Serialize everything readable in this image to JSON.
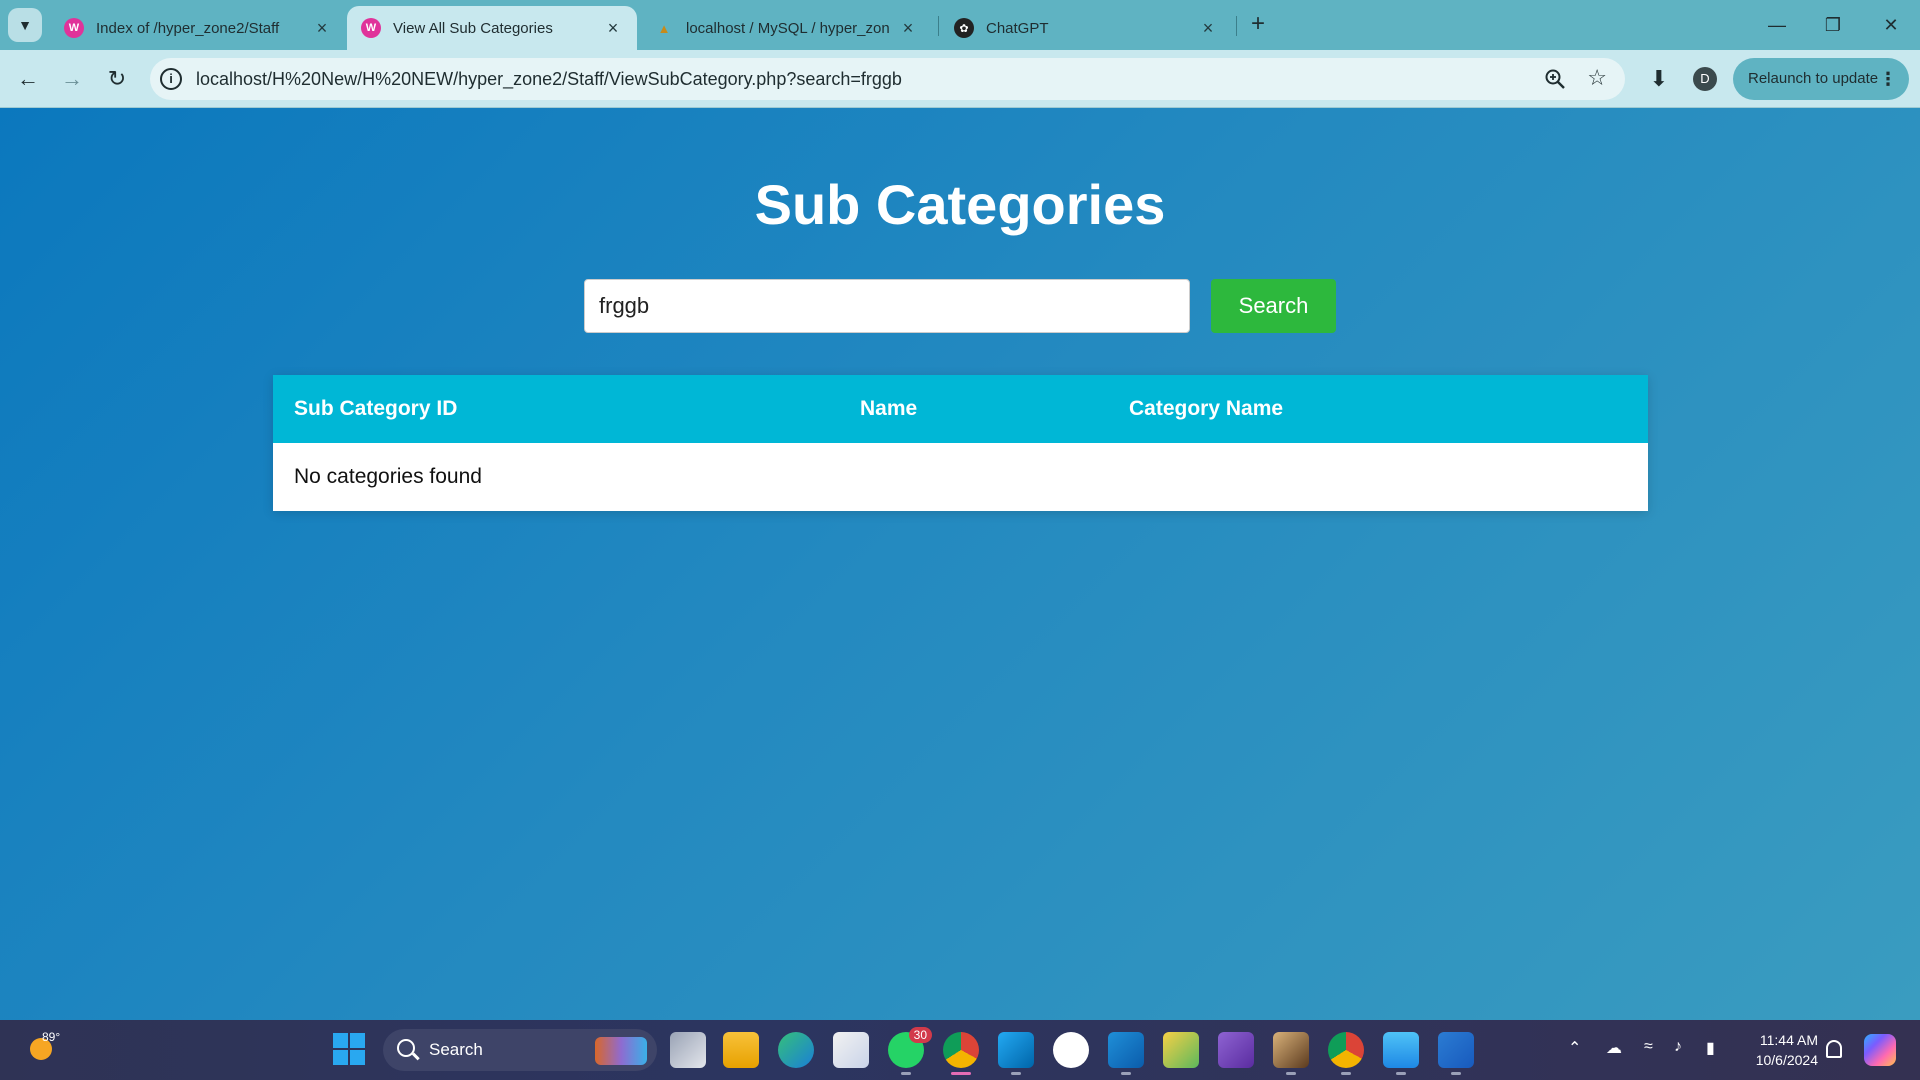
{
  "browser": {
    "tabs": [
      {
        "title": "Index of /hyper_zone2/Staff",
        "icon": "wamp-icon",
        "active": false
      },
      {
        "title": "View All Sub Categories",
        "icon": "wamp-icon",
        "active": true
      },
      {
        "title": "localhost / MySQL / hyper_zone",
        "icon": "phpmyadmin-icon",
        "active": false
      },
      {
        "title": "ChatGPT",
        "icon": "chatgpt-icon",
        "active": false
      }
    ],
    "url": "localhost/H%20New/H%20NEW/hyper_zone2/Staff/ViewSubCategory.php?search=frggb",
    "profile_initial": "D",
    "relaunch_label": "Relaunch to update"
  },
  "page": {
    "title": "Sub Categories",
    "search_value": "frggb",
    "search_button": "Search",
    "table": {
      "headers": [
        "Sub Category ID",
        "Name",
        "Category Name"
      ],
      "empty_message": "No categories found"
    }
  },
  "taskbar": {
    "weather_temp": "89°",
    "search_label": "Search",
    "whatsapp_badge": "30",
    "time": "11:44 AM",
    "date": "10/6/2024"
  },
  "colors": {
    "page_gradient_start": "#0b78be",
    "page_gradient_end": "#3a9cc0",
    "table_header": "#00b7d6",
    "search_button": "#2db83d",
    "tab_strip": "#5fb3c2",
    "toolbar": "#c8e8ee"
  }
}
